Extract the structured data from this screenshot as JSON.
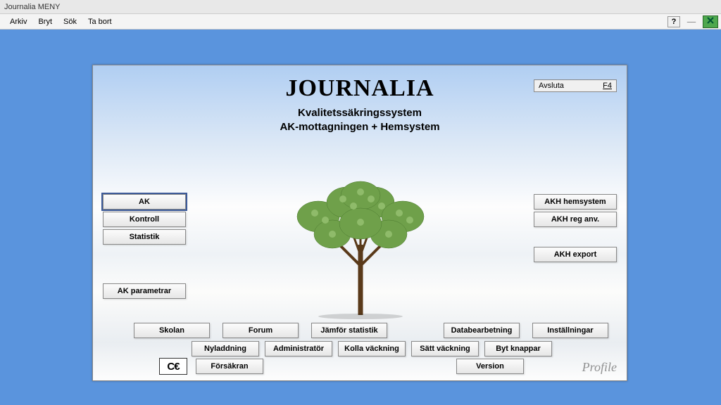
{
  "window": {
    "title": "Journalia   MENY",
    "menu": [
      "Arkiv",
      "Bryt",
      "Sök",
      "Ta bort"
    ]
  },
  "header": {
    "title": "JOURNALIA",
    "subtitle1": "Kvalitetssäkringssystem",
    "subtitle2": "AK-mottagningen + Hemsystem"
  },
  "avsluta": {
    "label": "Avsluta",
    "key": "F4"
  },
  "left": {
    "ak": "AK",
    "kontroll": "Kontroll",
    "statistik": "Statistik",
    "ak_parametrar": "AK parametrar"
  },
  "right": {
    "akh_hemsystem": "AKH hemsystem",
    "akh_reg_anv": "AKH reg anv.",
    "akh_export": "AKH export"
  },
  "row1": {
    "skolan": "Skolan",
    "forum": "Forum",
    "jamfor": "Jämför statistik",
    "databearbetning": "Databearbetning",
    "installningar": "Inställningar"
  },
  "row2": {
    "nyladdning": "Nyladdning",
    "administrator": "Administratör",
    "kolla_vackning": "Kolla väckning",
    "satt_vackning": "Sätt väckning",
    "byt_knappar": "Byt knappar"
  },
  "row3": {
    "forsakran": "Försäkran",
    "version": "Version"
  },
  "ce_label": "C€",
  "profile_logo": "Profile"
}
